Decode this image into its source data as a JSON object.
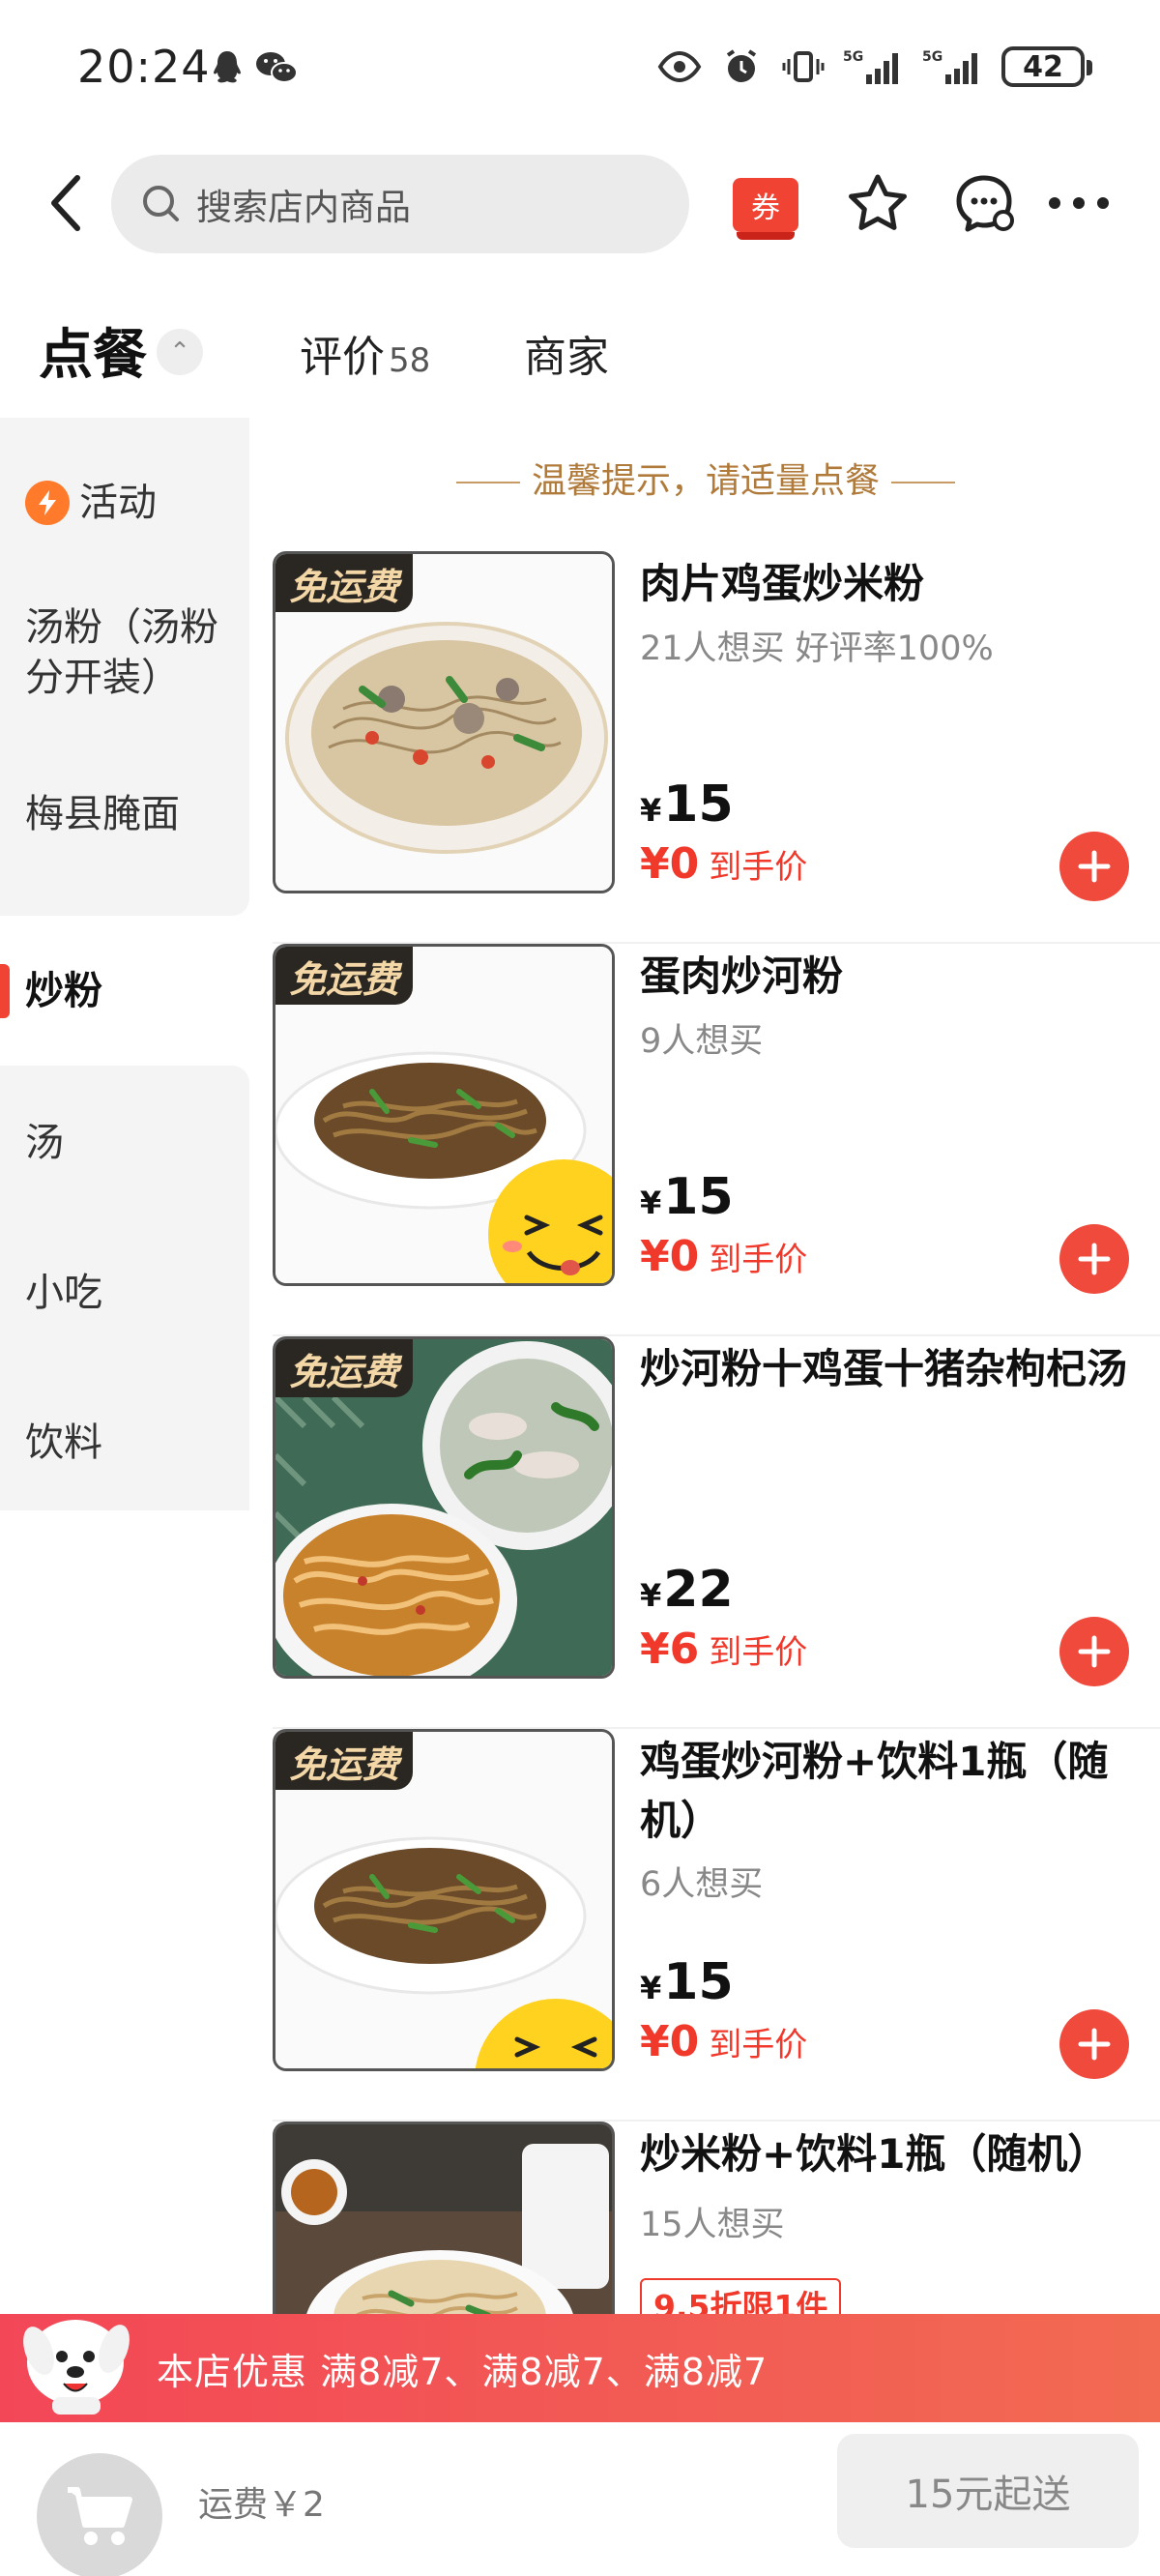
{
  "status_bar": {
    "time": "20:24",
    "battery": "42",
    "net1": "5G",
    "net2": "5G"
  },
  "nav": {
    "search_placeholder": "搜索店内商品",
    "coupon_label": "券"
  },
  "tabs": {
    "order": "点餐",
    "collapse": "⌃",
    "reviews": "评价",
    "reviews_count": "58",
    "merchant": "商家"
  },
  "sidebar": {
    "items": [
      {
        "label": "活动"
      },
      {
        "label": "汤粉（汤粉分开装）"
      },
      {
        "label": "梅县腌面"
      },
      {
        "label": "炒粉"
      },
      {
        "label": "汤"
      },
      {
        "label": "小吃"
      },
      {
        "label": "饮料"
      }
    ]
  },
  "tip": "温馨提示，请适量点餐",
  "products": [
    {
      "tag": "免运费",
      "name": "肉片鸡蛋炒米粉",
      "sub": "21人想买 好评率100%",
      "currency": "¥",
      "price": "15",
      "final_price": "¥0",
      "final_label": "到手价"
    },
    {
      "tag": "免运费",
      "name": "蛋肉炒河粉",
      "sub": "9人想买",
      "currency": "¥",
      "price": "15",
      "final_price": "¥0",
      "final_label": "到手价"
    },
    {
      "tag": "免运费",
      "name": "炒河粉十鸡蛋十猪杂枸杞汤",
      "sub": "",
      "currency": "¥",
      "price": "22",
      "final_price": "¥6",
      "final_label": "到手价"
    },
    {
      "tag": "免运费",
      "name": "鸡蛋炒河粉+饮料1瓶（随机）",
      "sub": "6人想买",
      "currency": "¥",
      "price": "15",
      "final_price": "¥0",
      "final_label": "到手价"
    },
    {
      "tag": "",
      "name": "炒米粉+饮料1瓶（随机）",
      "sub": "15人想买",
      "discount": "9.5折限1件"
    }
  ],
  "promo": {
    "text": "本店优惠  满8减7、满8减7、满8减7"
  },
  "bottom": {
    "fee": "运费￥2",
    "min_order": "15元起送"
  },
  "colors": {
    "accent": "#f04333",
    "promo_start": "#f34757",
    "promo_end": "#f26a52",
    "tip": "#b07a3a"
  }
}
